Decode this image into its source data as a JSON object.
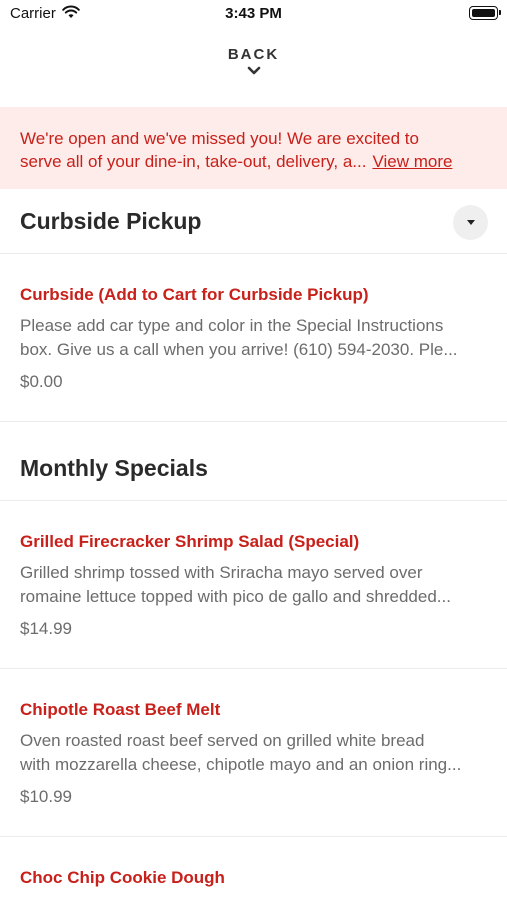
{
  "status_bar": {
    "carrier": "Carrier",
    "time": "3:43 PM"
  },
  "nav": {
    "back_label": "BACK"
  },
  "banner": {
    "line1": "We're open and we've missed you! We are excited to",
    "line2": "serve all of your dine-in, take-out, delivery, a...",
    "view_more": "View more"
  },
  "sections": [
    {
      "title": "Curbside Pickup",
      "items": [
        {
          "name": "Curbside (Add to Cart for Curbside Pickup)",
          "desc_line1": "Please add car type and color in the Special Instructions",
          "desc_line2": "box. Give us a call when you arrive! (610) 594-2030. Ple...",
          "price": "$0.00"
        }
      ]
    },
    {
      "title": "Monthly Specials",
      "items": [
        {
          "name": "Grilled Firecracker Shrimp Salad (Special)",
          "desc_line1": "Grilled shrimp tossed with Sriracha mayo served over",
          "desc_line2": "romaine lettuce topped with pico de gallo and shredded...",
          "price": "$14.99"
        },
        {
          "name": "Chipotle Roast Beef Melt",
          "desc_line1": "Oven roasted roast beef served on grilled white bread",
          "desc_line2": "with mozzarella cheese, chipotle mayo and an onion ring...",
          "price": "$10.99"
        },
        {
          "name": "Choc Chip Cookie Dough"
        }
      ]
    }
  ],
  "colors": {
    "accent": "#c8201a",
    "banner_bg": "#fdecea",
    "body_text": "#6c6c6c"
  },
  "icons": [
    "wifi-icon",
    "battery-icon",
    "chevron-down-icon",
    "caret-down-icon"
  ]
}
